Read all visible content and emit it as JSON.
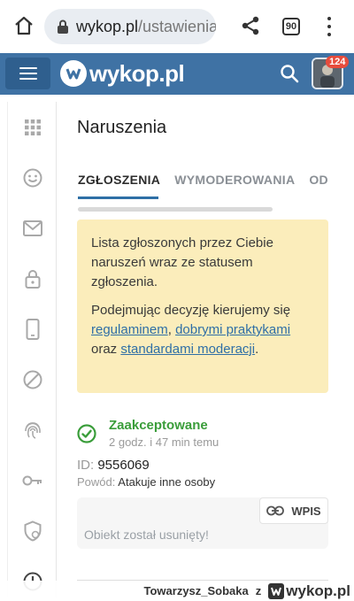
{
  "browser": {
    "url_host": "wykop.pl",
    "url_path": "/ustawienia",
    "tab_count": "90",
    "icons": [
      "home-icon",
      "lock-icon",
      "share-icon",
      "tabs-icon",
      "more-vert-icon"
    ]
  },
  "header": {
    "logo_text": "wykop.pl",
    "notification_count": "124",
    "colors": {
      "bar": "#3f72a4",
      "badge": "#e74c3c"
    }
  },
  "sidebar": {
    "items": [
      {
        "icon": "grid-icon"
      },
      {
        "icon": "smiley-icon"
      },
      {
        "icon": "mail-icon"
      },
      {
        "icon": "lock-icon"
      },
      {
        "icon": "phone-icon"
      },
      {
        "icon": "block-icon"
      },
      {
        "icon": "fingerprint-icon"
      },
      {
        "icon": "key-icon"
      },
      {
        "icon": "shield-icon"
      },
      {
        "icon": "clock-icon"
      }
    ]
  },
  "main": {
    "title": "Naruszenia",
    "tabs": [
      {
        "label": "ZGŁOSZENIA",
        "active": true
      },
      {
        "label": "WYMODEROWANIA",
        "active": false
      },
      {
        "label": "OD",
        "active": false
      }
    ],
    "notice": {
      "line1": "Lista zgłoszonych przez Ciebie naruszeń wraz ze statusem zgłoszenia.",
      "p2_prefix": "Podejmując decyzję kierujemy się ",
      "link_rules": "regulaminem",
      "sep1": ", ",
      "link_practices": "dobrymi praktykami",
      "sep2": " oraz ",
      "link_standards": "standardami moderacji",
      "suffix": "."
    },
    "report": {
      "status": "Zaakceptowane",
      "time": "2 godz. i 47 min temu",
      "id_label": "ID:",
      "id_value": "9556069",
      "reason_label": "Powód:",
      "reason_value": "Atakuje inne osoby",
      "entry_button": "WPIS",
      "removed_text": "Obiekt został usunięty!"
    }
  },
  "watermark": {
    "user": "Towarzysz_Sobaka",
    "connector": "z",
    "logo_text": "wykop.pl"
  }
}
